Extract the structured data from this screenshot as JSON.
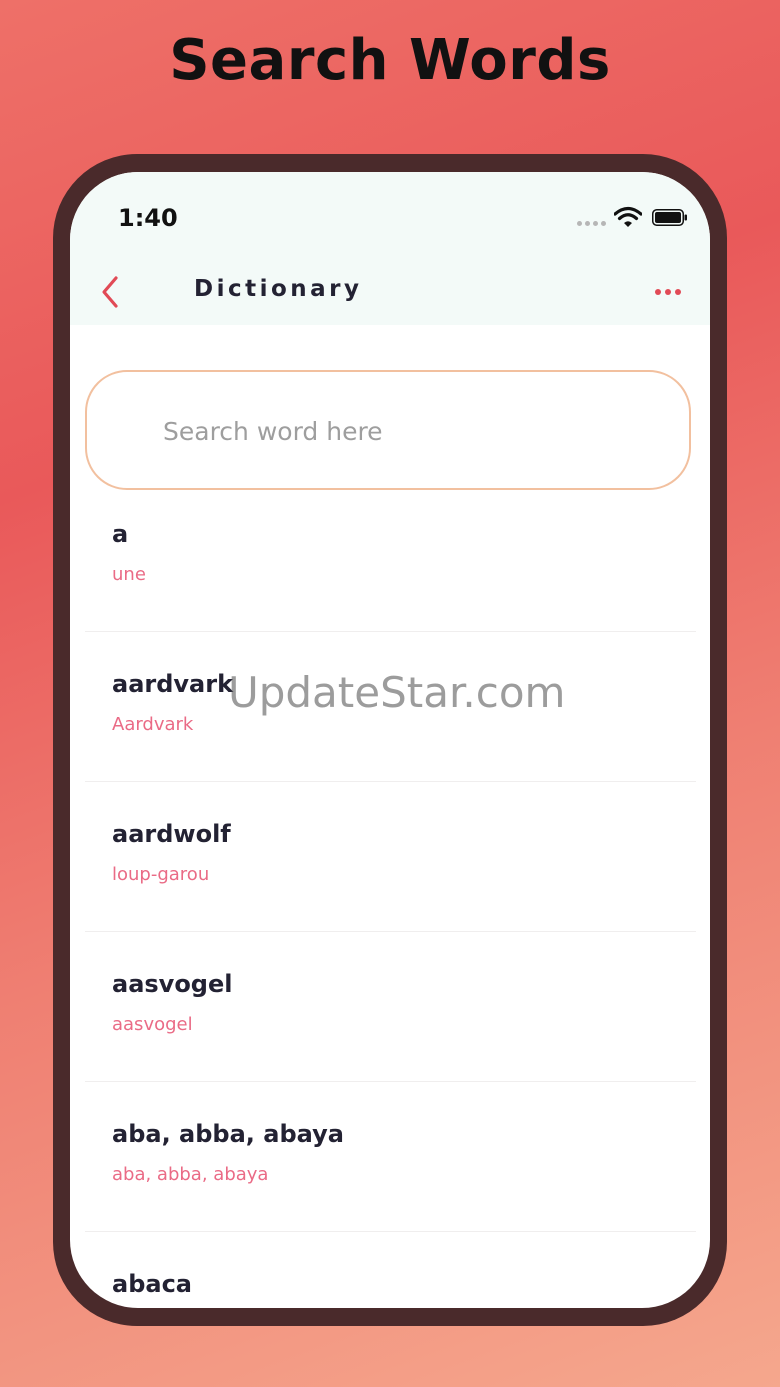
{
  "headline": "Search Words",
  "status_bar": {
    "time": "1:40",
    "icons": [
      "signal-dots-icon",
      "wifi-icon",
      "battery-icon"
    ]
  },
  "nav": {
    "back_icon": "chevron-left-icon",
    "title": "Dictionary",
    "more_icon": "more-dots-icon"
  },
  "search": {
    "placeholder": "Search word here",
    "value": ""
  },
  "words": [
    {
      "word": "a",
      "translation": "une"
    },
    {
      "word": "aardvark",
      "translation": "Aardvark"
    },
    {
      "word": "aardwolf",
      "translation": "loup-garou"
    },
    {
      "word": "aasvogel",
      "translation": "aasvogel"
    },
    {
      "word": "aba, abba, abaya",
      "translation": "aba, abba, abaya"
    },
    {
      "word": "abaca",
      "translation": ""
    }
  ],
  "watermark": "UpdateStar.com",
  "colors": {
    "accent": "#e14a56",
    "translation": "#ea6b86",
    "search_border": "#f2c09f",
    "frame": "#4a2a2b",
    "topbar_bg": "#f3faf8"
  }
}
